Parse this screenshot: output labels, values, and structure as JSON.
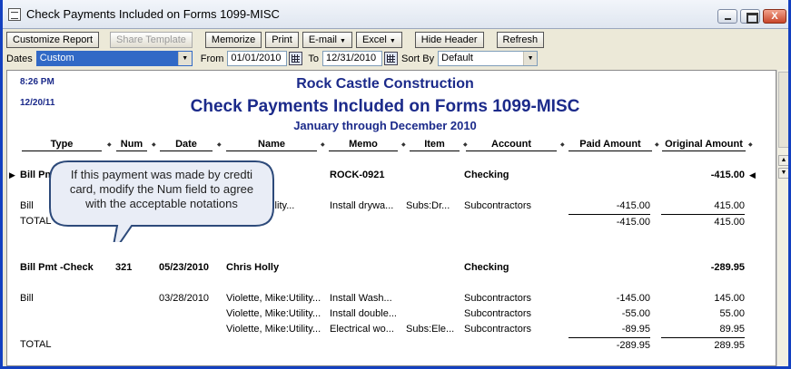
{
  "window": {
    "title": "Check Payments Included on Forms 1099-MISC",
    "close_glyph": "X"
  },
  "toolbar": {
    "customize": "Customize Report",
    "share": "Share Template",
    "memorize": "Memorize",
    "print": "Print",
    "email": "E-mail",
    "excel": "Excel",
    "hide_header": "Hide Header",
    "refresh": "Refresh",
    "arrow": "▼"
  },
  "filters": {
    "dates_label": "Dates",
    "dates_value": "Custom",
    "from_label": "From",
    "from_value": "01/01/2010",
    "to_label": "To",
    "to_value": "12/31/2010",
    "sortby_label": "Sort By",
    "sortby_value": "Default"
  },
  "report": {
    "time": "8:26 PM",
    "date": "12/20/11",
    "company": "Rock Castle Construction",
    "title": "Check Payments Included on Forms 1099-MISC",
    "range": "January through December 2010",
    "columns": [
      "Type",
      "Num",
      "Date",
      "Name",
      "Memo",
      "Item",
      "Account",
      "Paid Amount",
      "Original Amount"
    ],
    "groups": [
      {
        "type": "Bill Pmt -Check",
        "type_visible": "Bill Pm",
        "num": "",
        "date": "",
        "name": "Larry Wilson",
        "name_visible": "lson",
        "memo": "ROCK-0921",
        "account": "Checking",
        "original": "-415.00",
        "lines": [
          {
            "type": "Bill",
            "date": "",
            "name": "Wilson, Mike:Utility...",
            "name_visible": "ike:Utility...",
            "memo": "Install drywa...",
            "item": "Subs:Dr...",
            "account": "Subcontractors",
            "paid": "-415.00",
            "original": "415.00"
          }
        ],
        "total_label": "TOTAL",
        "total_paid": "-415.00",
        "total_original": "415.00"
      },
      {
        "type": "Bill Pmt -Check",
        "num": "321",
        "date": "05/23/2010",
        "name": "Chris Holly",
        "memo": "",
        "account": "Checking",
        "original": "-289.95",
        "lines": [
          {
            "type": "Bill",
            "date": "03/28/2010",
            "name": "Violette, Mike:Utility...",
            "memo": "Install Wash...",
            "item": "",
            "account": "Subcontractors",
            "paid": "-145.00",
            "original": "145.00"
          },
          {
            "type": "",
            "date": "",
            "name": "Violette, Mike:Utility...",
            "memo": "Install double...",
            "item": "",
            "account": "Subcontractors",
            "paid": "-55.00",
            "original": "55.00"
          },
          {
            "type": "",
            "date": "",
            "name": "Violette, Mike:Utility...",
            "memo": "Electrical wo...",
            "item": "Subs:Ele...",
            "account": "Subcontractors",
            "paid": "-89.95",
            "original": "89.95"
          }
        ],
        "total_label": "TOTAL",
        "total_paid": "-289.95",
        "total_original": "289.95"
      }
    ]
  },
  "callout": {
    "text": "If this payment was made by credti card, modify the Num field to agree with the acceptable notations"
  },
  "colors": {
    "report_text": "#1b2a8a",
    "window_border": "#1340c0",
    "selected_combo": "#3169c6"
  }
}
